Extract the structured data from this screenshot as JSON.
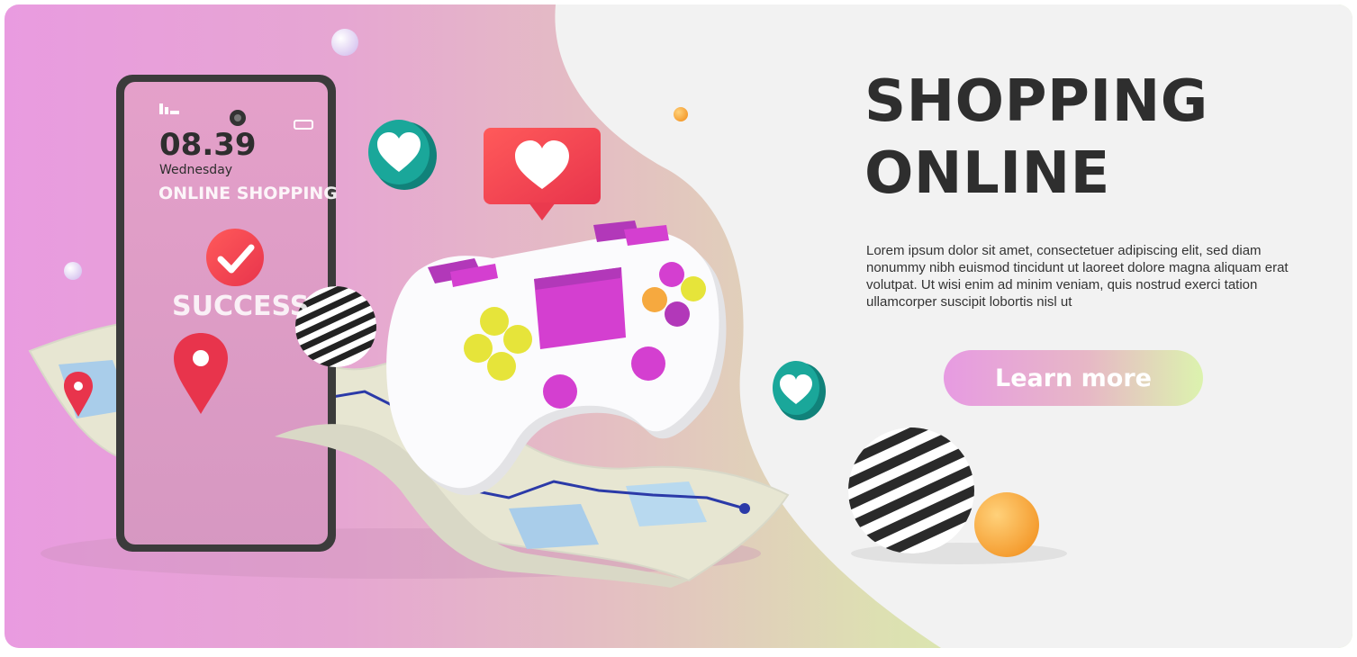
{
  "hero": {
    "title_line1": "SHOPPING",
    "title_line2": "ONLINE",
    "body": "Lorem ipsum dolor sit amet, consectetuer adipiscing elit, sed diam nonummy nibh euismod tincidunt ut laoreet dolore magna aliquam erat volutpat. Ut wisi enim ad minim veniam, quis nostrud exerci tation ullamcorper suscipit lobortis nisl ut",
    "cta_label": "Learn more"
  },
  "phone": {
    "time": "08.39",
    "day": "Wednesday",
    "screen_title": "ONLINE SHOPPING",
    "status": "SUCCESS"
  },
  "colors": {
    "heading": "#2e2e2e",
    "accent_magenta": "#d43fd0",
    "accent_red": "#f0434f",
    "accent_teal": "#1aa79a",
    "accent_yellow": "#e6e43a",
    "accent_orange": "#f6a93f"
  },
  "icons": [
    "heart-icon",
    "check-icon",
    "map-pin-icon",
    "gamepad-illustration",
    "map-illustration"
  ]
}
